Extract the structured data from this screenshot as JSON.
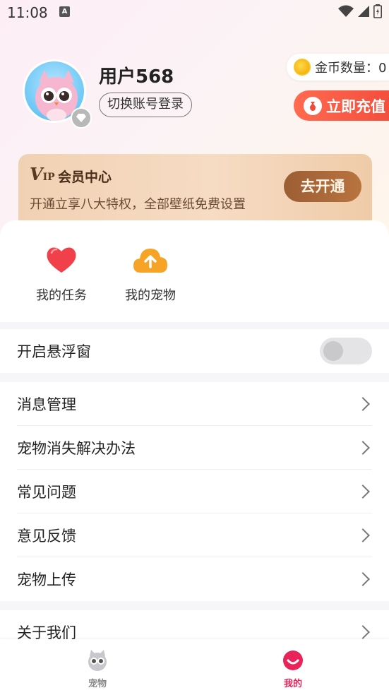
{
  "status_bar": {
    "time": "11:08",
    "notification_badge": "A"
  },
  "profile": {
    "username": "用户568",
    "switch_account": "切换账号登录",
    "coins_label": "金币数量：0",
    "recharge_label": "立即充值"
  },
  "vip": {
    "logo_v": "V",
    "logo_ip": "IP",
    "title": "会员中心",
    "description": "开通立享八大特权，全部壁纸免费设置",
    "button": "去开通"
  },
  "shortcuts": [
    {
      "label": "我的任务",
      "icon": "heart-icon"
    },
    {
      "label": "我的宠物",
      "icon": "cloud-upload-icon"
    }
  ],
  "settings": {
    "floating_window": {
      "label": "开启悬浮窗",
      "enabled": false
    }
  },
  "menu": [
    {
      "label": "消息管理"
    },
    {
      "label": "宠物消失解决办法"
    },
    {
      "label": "常见问题"
    },
    {
      "label": "意见反馈"
    },
    {
      "label": "宠物上传"
    }
  ],
  "about": {
    "label": "关于我们"
  },
  "bottom_nav": [
    {
      "label": "宠物",
      "icon": "pet-icon",
      "active": false
    },
    {
      "label": "我的",
      "icon": "mine-icon",
      "active": true
    }
  ],
  "colors": {
    "accent_red": "#f14c3b",
    "vip_brown": "#9c5e34",
    "nav_active": "#e8245a",
    "nav_inactive": "#888888"
  }
}
